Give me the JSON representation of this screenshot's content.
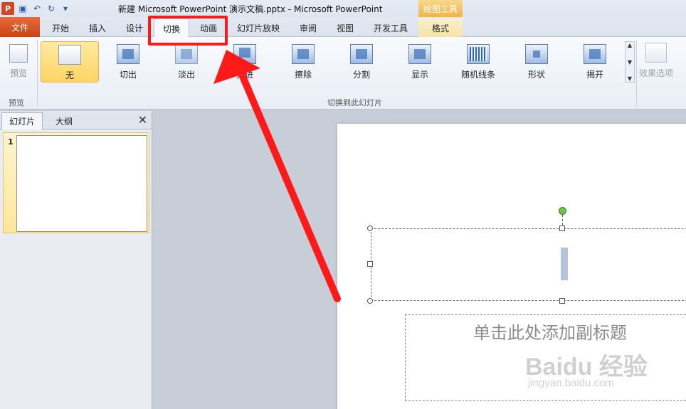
{
  "window": {
    "title": "新建 Microsoft PowerPoint 演示文稿.pptx  -  Microsoft PowerPoint",
    "context_tool": "绘图工具"
  },
  "tabs": [
    "文件",
    "开始",
    "插入",
    "设计",
    "切换",
    "动画",
    "幻灯片放映",
    "审阅",
    "视图",
    "开发工具",
    "格式"
  ],
  "ribbon": {
    "preview_label": "预览",
    "preview_group": "预览",
    "transitions": [
      "无",
      "切出",
      "淡出",
      "推进",
      "擦除",
      "分割",
      "显示",
      "随机线条",
      "形状",
      "揭开"
    ],
    "group_label": "切换到此幻灯片",
    "effect_options": "效果选项"
  },
  "panel": {
    "tab_slides": "幻灯片",
    "tab_outline": "大纲",
    "close": "✕",
    "slide_number": "1"
  },
  "slide": {
    "subtitle_placeholder": "单击此处添加副标题"
  },
  "watermark": {
    "brand": "Baidu 经验",
    "url": "jingyan.baidu.com"
  },
  "colors": {
    "file_tab": "#d24726",
    "highlight": "#ff1a1a",
    "selected": "#ffd465"
  }
}
